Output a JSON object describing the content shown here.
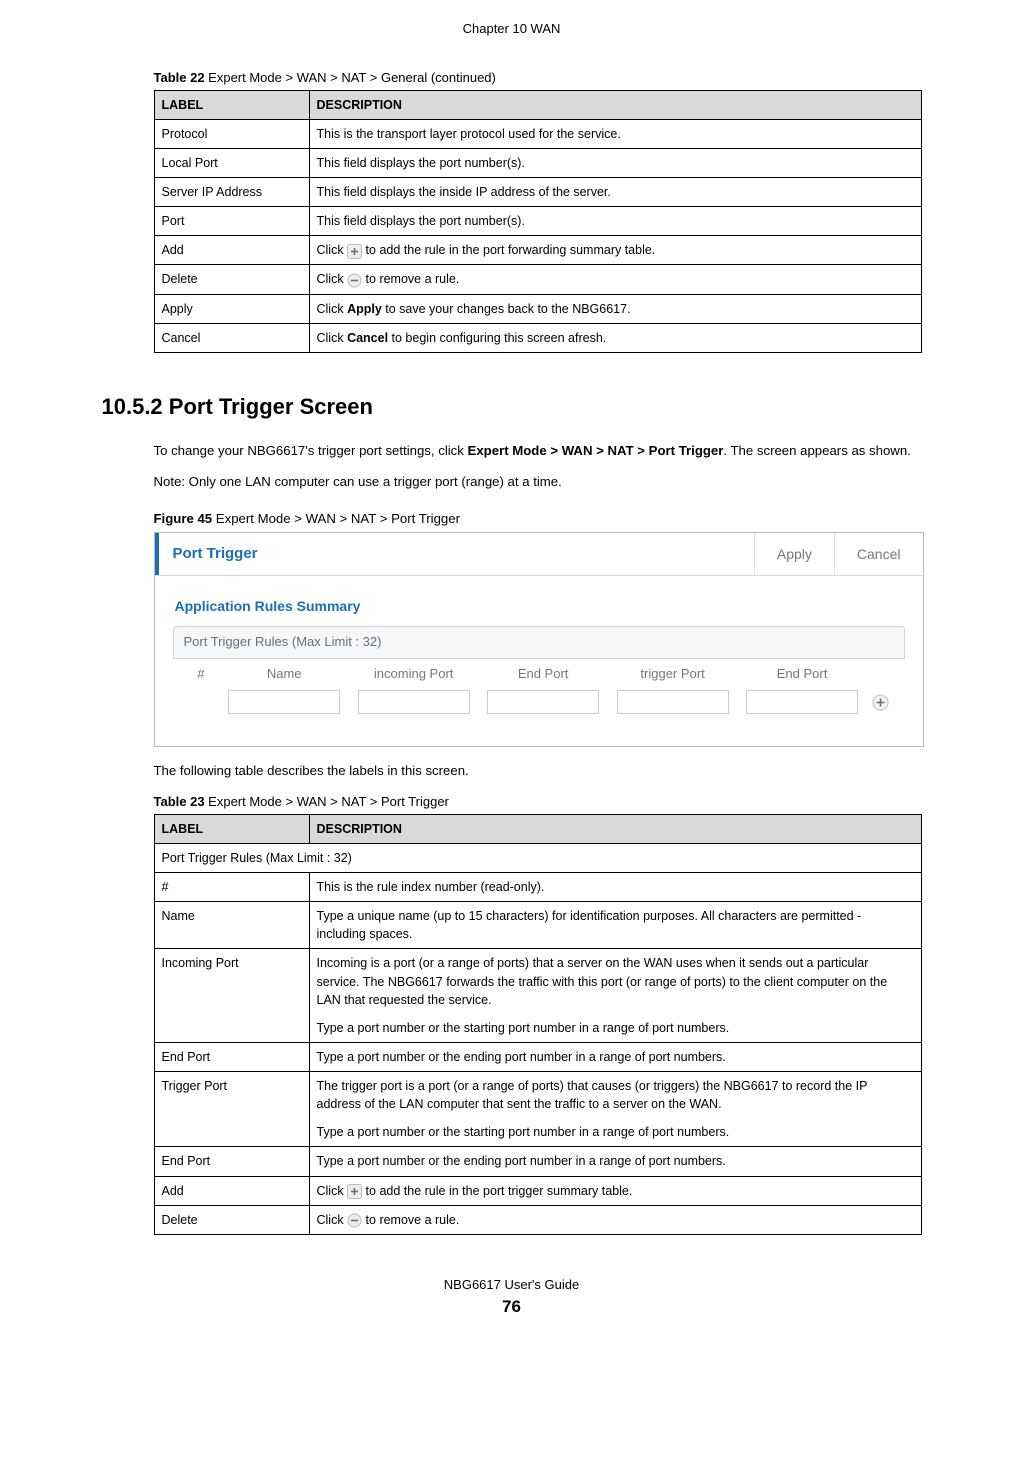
{
  "chapter": "Chapter 10 WAN",
  "table22": {
    "caption_bold": "Table 22",
    "caption_rest": "   Expert Mode > WAN > NAT > General (continued)",
    "head_label": "LABEL",
    "head_desc": "DESCRIPTION",
    "rows": [
      {
        "label": "Protocol",
        "desc": "This is the transport layer protocol used for the service."
      },
      {
        "label": "Local Port",
        "desc": "This field displays the port number(s)."
      },
      {
        "label": "Server IP Address",
        "desc": "This field displays the inside IP address of the server."
      },
      {
        "label": "Port",
        "desc": "This field displays the port number(s)."
      },
      {
        "label": "Add",
        "desc_pre": "Click ",
        "desc_post": " to add the rule in the port forwarding summary table.",
        "icon": "plus"
      },
      {
        "label": "Delete",
        "desc_pre": "Click ",
        "desc_post": "  to remove a rule.",
        "icon": "minus"
      },
      {
        "label": "Apply",
        "desc_pre": "Click ",
        "bold": "Apply",
        "desc_post": " to save your changes back to the NBG6617."
      },
      {
        "label": "Cancel",
        "desc_pre": "Click ",
        "bold": "Cancel",
        "desc_post": " to begin configuring this screen afresh."
      }
    ]
  },
  "section": {
    "num_title": "10.5.2  Port Trigger Screen",
    "para1_pre": "To change your NBG6617's trigger port settings, click ",
    "para1_bold": "Expert Mode > WAN > NAT > Port Trigger",
    "para1_post": ". The screen appears as shown.",
    "note": "Note: Only one LAN computer can use a trigger port (range) at a time.",
    "fig_caption_bold": "Figure 45",
    "fig_caption_rest": "   Expert Mode > WAN > NAT > Port Trigger"
  },
  "screenshot": {
    "title": "Port Trigger",
    "apply": "Apply",
    "cancel": "Cancel",
    "subtitle": "Application Rules Summary",
    "rulebar": "Port Trigger Rules (Max Limit : 32)",
    "cols": {
      "num": "#",
      "name": "Name",
      "incoming": "incoming Port",
      "endport": "End Port",
      "trigger": "trigger Port",
      "endport2": "End Port"
    }
  },
  "para_after_fig": "The following table describes the labels in this screen.",
  "table23": {
    "caption_bold": "Table 23",
    "caption_rest": "   Expert Mode > WAN > NAT > Port Trigger",
    "head_label": "LABEL",
    "head_desc": "DESCRIPTION",
    "spanrow": "Port Trigger Rules (Max Limit : 32)",
    "rows": [
      {
        "label": "#",
        "desc": "This is the rule index number (read-only)."
      },
      {
        "label": "Name",
        "desc": "Type a unique name (up to 15 characters) for identification purposes. All characters are permitted - including spaces."
      },
      {
        "label": "Incoming Port",
        "desc_p1": "Incoming is a port (or a range of ports) that a server on the WAN uses when it sends out a particular service. The NBG6617 forwards the traffic with this port (or range of ports) to the client computer on the LAN that requested the service.",
        "desc_p2": "Type a port number or the starting port number in a range of port numbers."
      },
      {
        "label": "End Port",
        "desc": "Type a port number or the ending port number in a range of port numbers."
      },
      {
        "label": "Trigger Port",
        "desc_p1": "The trigger port is a port (or a range of ports) that causes (or triggers) the NBG6617 to record the IP address of the LAN computer that sent the traffic to a server on the WAN.",
        "desc_p2": "Type a port number or the starting port number in a range of port numbers."
      },
      {
        "label": "End Port",
        "desc": "Type a port number or the ending port number in a range of port numbers."
      },
      {
        "label": "Add",
        "desc_pre": "Click ",
        "desc_post": " to add the rule in the port trigger summary table.",
        "icon": "plus"
      },
      {
        "label": "Delete",
        "desc_pre": "Click ",
        "desc_post": "  to remove a rule.",
        "icon": "minus"
      }
    ]
  },
  "footer": {
    "guide": "NBG6617 User's Guide",
    "page": "76"
  }
}
